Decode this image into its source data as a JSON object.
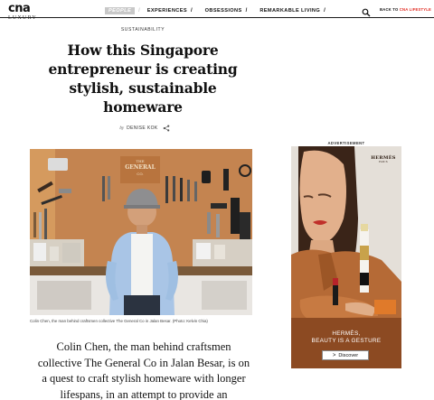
{
  "header": {
    "logo_main": "cna",
    "logo_sub": "LUXURY",
    "nav": [
      {
        "label": "PEOPLE",
        "sep": "/",
        "active": true
      },
      {
        "label": "EXPERIENCES",
        "sep": "/",
        "active": false
      },
      {
        "label": "OBSESSIONS",
        "sep": "/",
        "active": false
      },
      {
        "label": "REMARKABLE LIVING",
        "sep": "/",
        "active": false
      }
    ],
    "back_prefix": "BACK TO ",
    "back_accent": "CNA LIFESTYLE",
    "accent_color": "#e1261c"
  },
  "article": {
    "category": "SUSTAINABILITY",
    "headline": "How this Singapore entrepreneur is creating stylish, sustainable homeware",
    "byline_by": "by",
    "byline_name": "DENISE KOK",
    "photo_sign_line1": "THE",
    "photo_sign_line2": "GENERAL",
    "photo_sign_line3": "CO.",
    "caption": "Colin Chen, the man behind craftsmen collective The General Co in Jalan Besar. (Photo: Kelvin Chia)",
    "body": "Colin Chen, the man behind craftsmen collective The General Co in Jalan Besar, is on a quest to craft stylish homeware with longer lifespans, in an attempt to provide an"
  },
  "ad": {
    "label": "ADVERTISEMENT",
    "brand": "HERMÈS",
    "brand_city": "PARIS",
    "tagline_1": "HERMÈS,",
    "tagline_2": "BEAUTY IS A GESTURE",
    "cta": "Discover",
    "cta_chevron": ">"
  }
}
